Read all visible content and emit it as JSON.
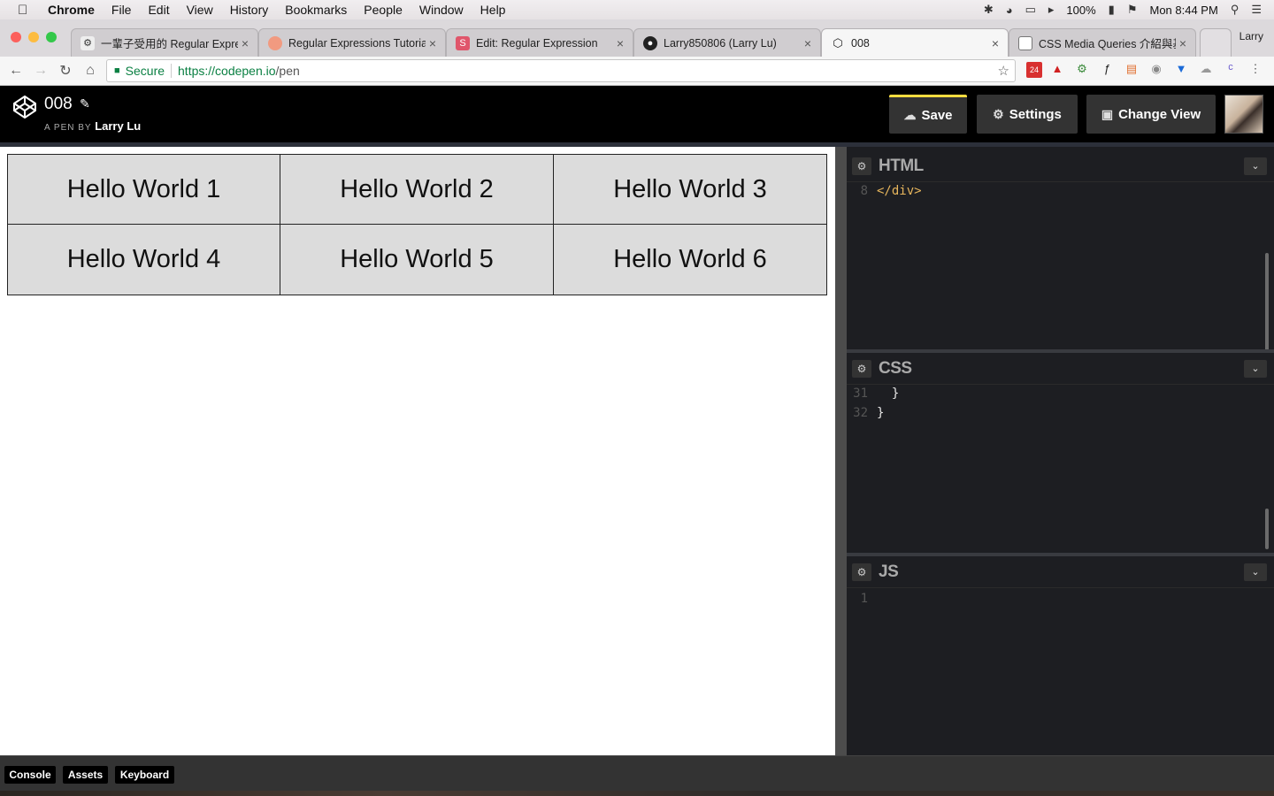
{
  "menubar": {
    "app": "Chrome",
    "items": [
      "File",
      "Edit",
      "View",
      "History",
      "Bookmarks",
      "People",
      "Window",
      "Help"
    ],
    "battery": "100%",
    "clock": "Mon 8:44 PM"
  },
  "tabs": [
    {
      "title": "一輩子受用的 Regular Expre",
      "icon": "regex-site-icon"
    },
    {
      "title": "Regular Expressions Tutoria",
      "icon": "orange-circle-icon"
    },
    {
      "title": "Edit: Regular Expression",
      "icon": "s-square-icon"
    },
    {
      "title": "Larry850806 (Larry Lu)",
      "icon": "github-icon"
    },
    {
      "title": "008",
      "icon": "codepen-icon"
    },
    {
      "title": "CSS Media Queries 介紹與基",
      "icon": "document-icon"
    }
  ],
  "profile_name": "Larry",
  "address": {
    "secure_label": "Secure",
    "url_scheme_host": "https://codepen.io",
    "url_path": "/pen"
  },
  "extensions": {
    "calendar_badge": "24"
  },
  "codepen": {
    "pen_title": "008",
    "pen_by": "A PEN BY",
    "author": "Larry Lu",
    "save_label": "Save",
    "settings_label": "Settings",
    "change_view_label": "Change View"
  },
  "result": {
    "cells": [
      "Hello World 1",
      "Hello World 2",
      "Hello World 3",
      "Hello World 4",
      "Hello World 5",
      "Hello World 6"
    ]
  },
  "editors": {
    "html": {
      "title": "HTML",
      "lines": [
        {
          "n": "8",
          "code": "</div>"
        }
      ]
    },
    "css": {
      "title": "CSS",
      "lines": [
        {
          "n": "31",
          "code": "  }"
        },
        {
          "n": "32",
          "code": "}"
        }
      ]
    },
    "js": {
      "title": "JS",
      "lines": [
        {
          "n": "1",
          "code": ""
        }
      ]
    }
  },
  "footer": {
    "console_label": "Console",
    "assets_label": "Assets",
    "keyboard_label": "Keyboard"
  }
}
